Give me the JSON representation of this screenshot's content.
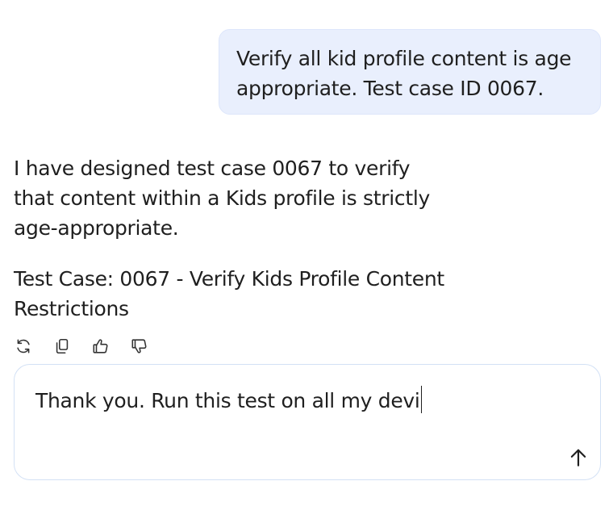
{
  "conversation": {
    "user_message": "Verify all kid profile content is age appropriate. Test case ID 0067.",
    "assistant_paragraph_1": "I have designed test case 0067 to verify that content within a Kids profile is strictly age-appropriate.",
    "assistant_paragraph_2": "Test Case: 0067 - Verify Kids Profile Content Restrictions"
  },
  "actions": {
    "icons": [
      "regenerate-icon",
      "copy-icon",
      "thumbs-up-icon",
      "thumbs-down-icon"
    ]
  },
  "composer": {
    "value": "Thank you. Run this test on all my devi",
    "send_icon": "arrow-up-icon"
  },
  "colors": {
    "user_bubble_bg": "#e9effd",
    "composer_border": "#d3e1f5",
    "text": "#1f1f1f"
  }
}
